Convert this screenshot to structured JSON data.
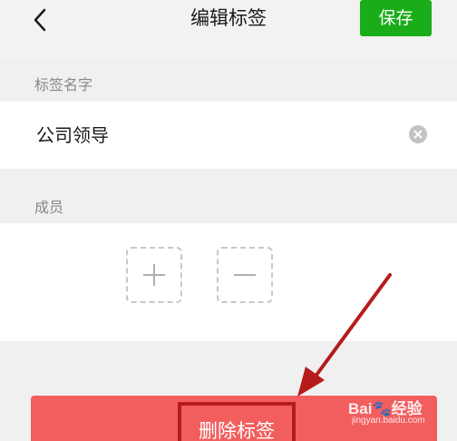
{
  "header": {
    "title": "编辑标签",
    "save_label": "保存"
  },
  "tag_name": {
    "section_label": "标签名字",
    "value": "公司领导"
  },
  "members": {
    "section_label": "成员"
  },
  "delete": {
    "label": "删除标签"
  },
  "watermark": {
    "brand": "Bai",
    "brand_suffix": "经验",
    "url": "jingyan.baidu.com"
  },
  "colors": {
    "save_green": "#1aad19",
    "delete_red": "#f25e5e",
    "annotation_red": "#b61b1b"
  }
}
